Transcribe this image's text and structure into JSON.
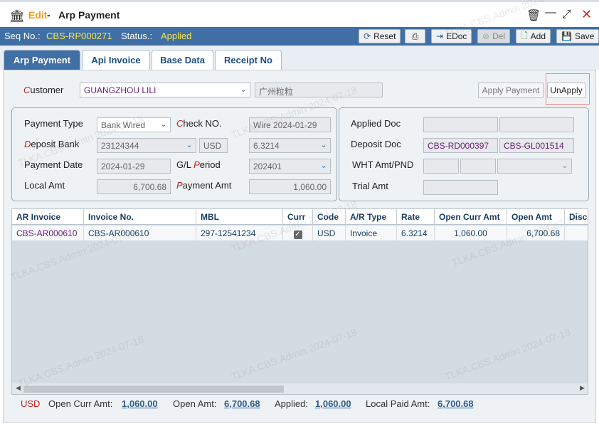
{
  "title": {
    "mode": "Edit",
    "separator": "-",
    "name": "Arp Payment"
  },
  "seq": {
    "label": "Seq No.:",
    "value": "CBS-RP000271",
    "status_label": "Status.:",
    "status_value": "Applied"
  },
  "toolbar": {
    "reset": "Reset",
    "edoc": "EDoc",
    "del": "Del",
    "add": "Add",
    "save": "Save"
  },
  "tabs": [
    {
      "label": "Arp Payment"
    },
    {
      "label": "Api Invoice"
    },
    {
      "label": "Base Data"
    },
    {
      "label": "Receipt No"
    }
  ],
  "form": {
    "customer_label_first": "C",
    "customer_label_rest": "ustomer",
    "customer_value": "GUANGZHOU LILI",
    "customer_cn": "广州粒粒",
    "apply_payment": "Apply Payment",
    "unapply": "UnApply",
    "payment_type_label": "Payment Type",
    "payment_type_value": "Bank Wired",
    "check_no_label_first": "C",
    "check_no_label_rest": "heck NO.",
    "check_no_value": "Wire 2024-01-29",
    "deposit_bank_label_first": "D",
    "deposit_bank_label_rest": "eposit Bank",
    "deposit_bank_value": "23124344",
    "currency_value": "USD",
    "rate_value": "6.3214",
    "payment_date_label": "Payment Date",
    "payment_date_value": "2024-01-29",
    "gl_period_label_a": "G/L ",
    "gl_period_label_b": "P",
    "gl_period_label_c": "eriod",
    "gl_period_value": "202401",
    "local_amt_label": "Local Amt",
    "local_amt_value": "6,700.68",
    "payment_amt_label_first": "P",
    "payment_amt_label_rest": "ayment Amt",
    "payment_amt_value": "1,060.00",
    "applied_doc_label": "Applied Doc",
    "deposit_doc_label": "Deposit Doc",
    "deposit_doc_1": "CBS-RD000397",
    "deposit_doc_2": "CBS-GL001514",
    "wht_label": "WHT Amt/PND",
    "trial_amt_label": "Trial Amt"
  },
  "grid": {
    "headers": [
      "AR Invoice",
      "Invoice No.",
      "MBL",
      "Curr",
      "Code",
      "A/R Type",
      "Rate",
      "Open Curr Amt",
      "Open Amt",
      "Disc"
    ],
    "rows": [
      {
        "ar_invoice": "CBS-AR000610",
        "invoice_no": "CBS-AR000610",
        "mbl": "297-12541234",
        "curr_checked": true,
        "code": "USD",
        "ar_type": "Invoice",
        "rate": "6.3214",
        "open_curr_amt": "1,060.00",
        "open_amt": "6,700.68"
      }
    ]
  },
  "footer": {
    "currency": "USD",
    "open_curr_label": "Open Curr Amt:",
    "open_curr_value": "1,060.00",
    "open_amt_label": "Open Amt:",
    "open_amt_value": "6,700.68",
    "applied_label": "Applied:",
    "applied_value": "1,060.00",
    "local_paid_label": "Local Paid Amt:",
    "local_paid_value": "6,700.68"
  },
  "watermark": "TLKA.CBS.Admin 2024-07-18",
  "colors": {
    "header_blue": "#3f6fa4",
    "status_yellow": "#f6e64d",
    "edit_orange": "#f19a1f",
    "required_red": "#c62020",
    "link_blue": "#2f5d8c"
  }
}
